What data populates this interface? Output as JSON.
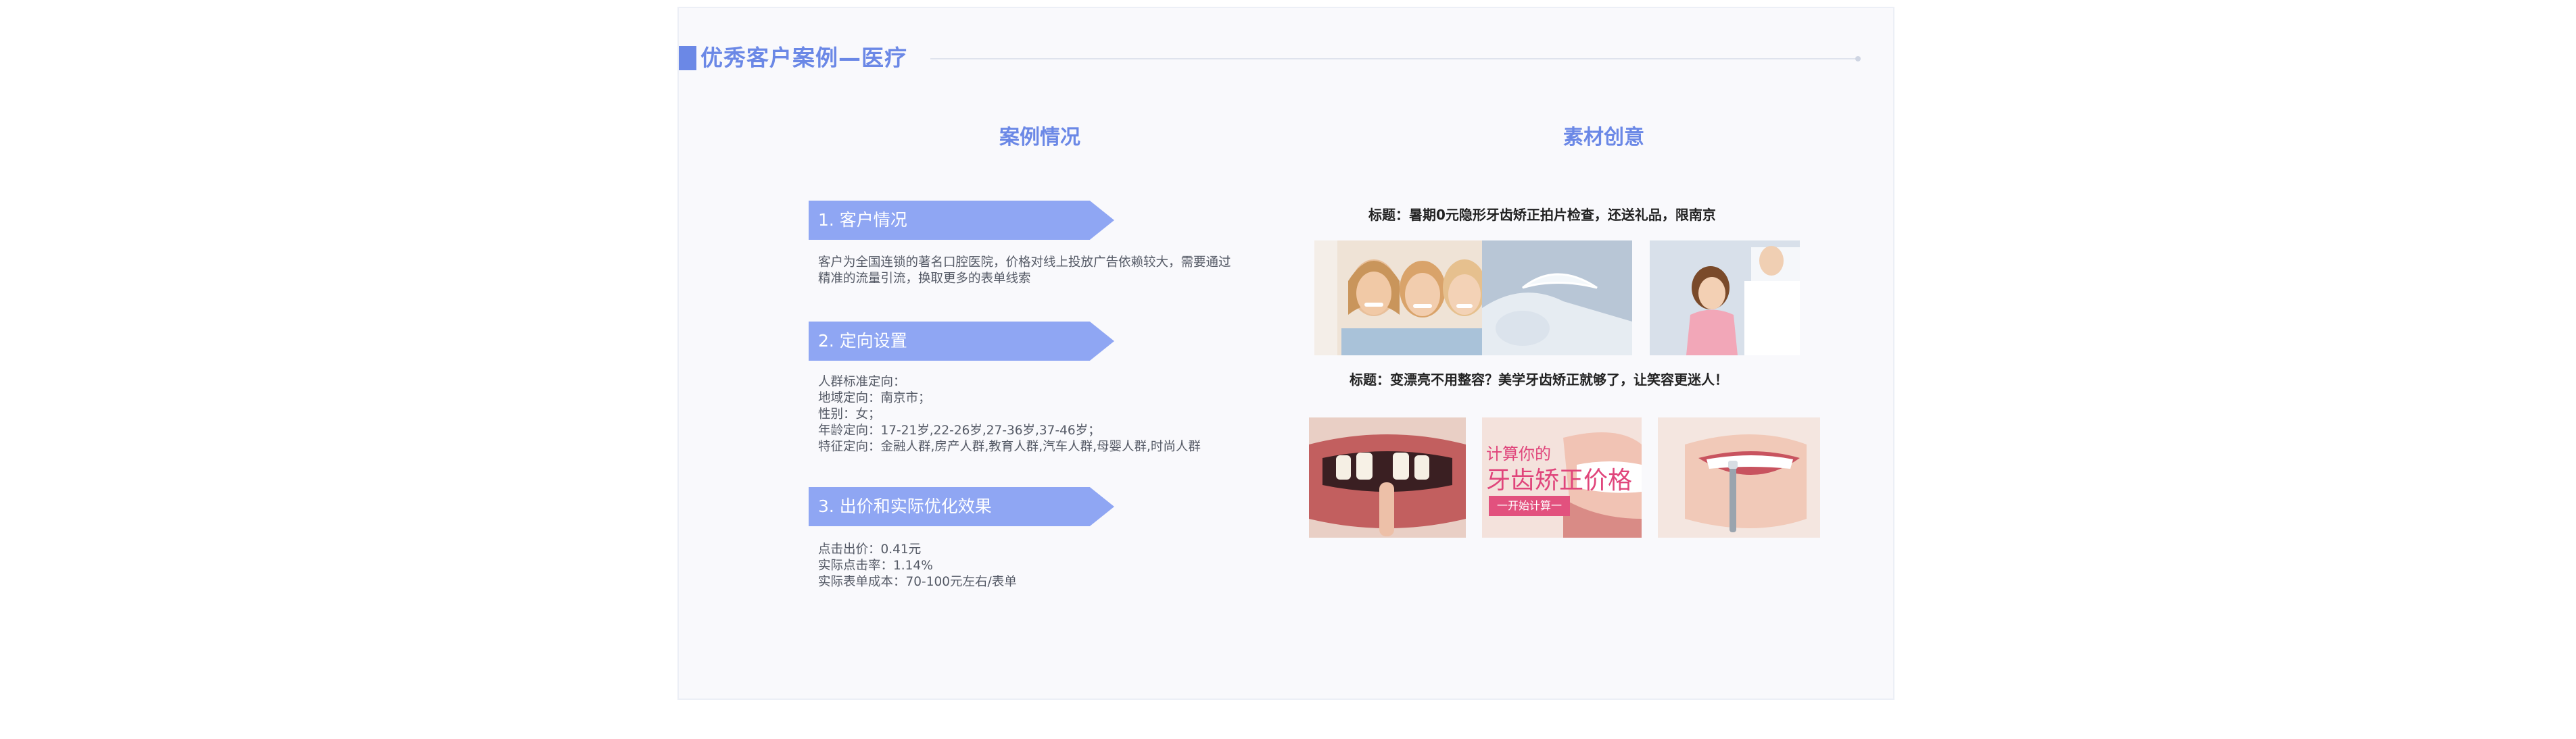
{
  "header": {
    "title": "优秀客户案例—医疗"
  },
  "columns": {
    "left_title": "案例情况",
    "right_title": "素材创意"
  },
  "sections": [
    {
      "heading": "1. 客户情况",
      "lines": [
        "客户为全国连锁的著名口腔医院，价格对线上投放广告依赖较大，需要通过",
        "精准的流量引流，换取更多的表单线索"
      ]
    },
    {
      "heading": "2. 定向设置",
      "lines": [
        "人群标准定向：",
        "地域定向：南京市；",
        "性别：女；",
        "年龄定向：17-21岁,22-26岁,27-36岁,37-46岁；",
        "特征定向：金融人群,房产人群,教育人群,汽车人群,母婴人群,时尚人群"
      ]
    },
    {
      "heading": "3. 出价和实际优化效果",
      "lines": [
        "点击出价：0.41元",
        "实际点击率：1.14%",
        "实际表单成本：70-100元左右/表单"
      ]
    }
  ],
  "creatives": {
    "caption_1": "标题：暑期0元隐形牙齿矫正拍片检查，还送礼品，限南京",
    "caption_2": "标题：变漂亮不用整容？美学牙齿矫正就够了，让笑容更迷人！",
    "promo_line_1": "计算你的",
    "promo_line_2": "牙齿矫正价格",
    "promo_button": "一开始计算一"
  },
  "colors": {
    "accent": "#6b88e6",
    "banner": "#8fa6f3",
    "body_text": "#555a66"
  }
}
